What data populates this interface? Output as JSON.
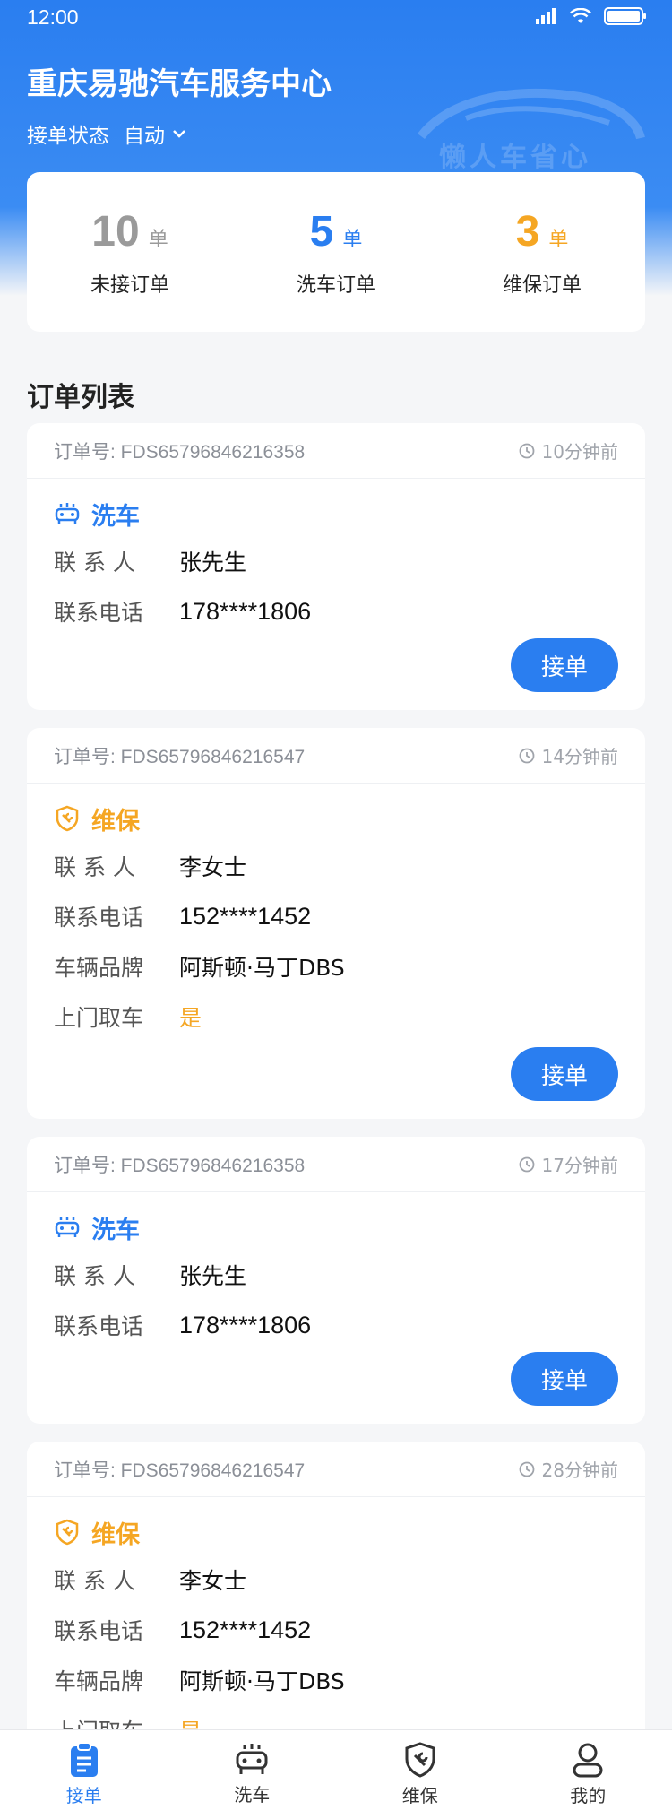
{
  "status_bar": {
    "time": "12:00"
  },
  "header": {
    "shop_name": "重庆易驰汽车服务中心",
    "accept_state_label": "接单状态",
    "accept_state_value": "自动",
    "watermark_text": "懒人车省心"
  },
  "stats": [
    {
      "value": "10",
      "unit": "单",
      "label": "未接订单",
      "color": "#9a9a9a"
    },
    {
      "value": "5",
      "unit": "单",
      "label": "洗车订单",
      "color": "#2a7ef0"
    },
    {
      "value": "3",
      "unit": "单",
      "label": "维保订单",
      "color": "#f5a623"
    }
  ],
  "section_title": "订单列表",
  "orders": [
    {
      "order_no": "订单号: FDS65796846216358",
      "time": "10分钟前",
      "type": "洗车",
      "contact_label": "联 系 人",
      "contact": "张先生",
      "phone_label": "联系电话",
      "phone": "178****1806",
      "button": "接单"
    },
    {
      "order_no": "订单号: FDS65796846216547",
      "time": "14分钟前",
      "type": "维保",
      "contact_label": "联 系 人",
      "contact": "李女士",
      "phone_label": "联系电话",
      "phone": "152****1452",
      "brand_label": "车辆品牌",
      "brand": "阿斯顿·马丁DBS",
      "pickup_label": "上门取车",
      "pickup": "是",
      "button": "接单"
    },
    {
      "order_no": "订单号: FDS65796846216358",
      "time": "17分钟前",
      "type": "洗车",
      "contact_label": "联 系 人",
      "contact": "张先生",
      "phone_label": "联系电话",
      "phone": "178****1806",
      "button": "接单"
    },
    {
      "order_no": "订单号: FDS65796846216547",
      "time": "28分钟前",
      "type": "维保",
      "contact_label": "联 系 人",
      "contact": "李女士",
      "phone_label": "联系电话",
      "phone": "152****1452",
      "brand_label": "车辆品牌",
      "brand": "阿斯顿·马丁DBS",
      "pickup_label": "上门取车",
      "pickup": "是",
      "button": "接单"
    }
  ],
  "colors": {
    "primary": "#2a7ef0",
    "wash": "#2a7ef0",
    "maintenance": "#f5a623"
  },
  "tabbar": [
    {
      "label": "接单",
      "icon": "clipboard-icon",
      "active": true
    },
    {
      "label": "洗车",
      "icon": "car-wash-icon",
      "active": false
    },
    {
      "label": "维保",
      "icon": "shield-wrench-icon",
      "active": false
    },
    {
      "label": "我的",
      "icon": "user-icon",
      "active": false
    }
  ]
}
